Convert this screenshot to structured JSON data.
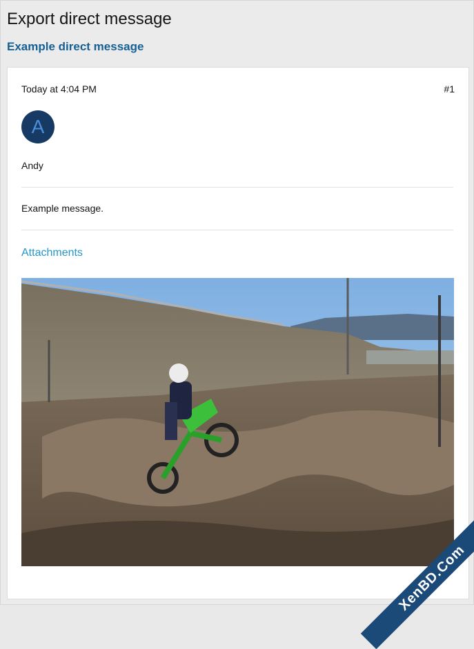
{
  "page": {
    "title": "Export direct message",
    "conversation_title": "Example direct message"
  },
  "message": {
    "timestamp": "Today at 4:04 PM",
    "number": "#1",
    "avatar_letter": "A",
    "author": "Andy",
    "body": "Example message.",
    "attachments_heading": "Attachments"
  },
  "attachment": {
    "alt": "Motocross rider jumping a dirt bike on a dirt track"
  },
  "watermark": {
    "text": "XenBD.Com"
  },
  "colors": {
    "link_blue": "#176093",
    "attachments_blue": "#2497c8",
    "avatar_bg": "#163a64",
    "avatar_letter": "#4a8fd8",
    "page_bg": "#ebebeb"
  }
}
